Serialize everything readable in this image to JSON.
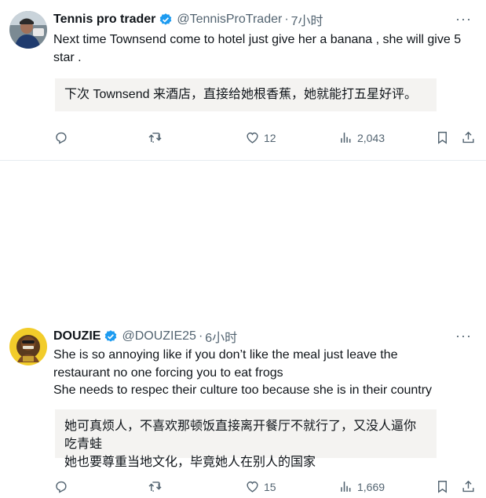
{
  "posts": [
    {
      "name": "Tennis pro trader",
      "handle": "@TennisProTrader",
      "time": "7小时",
      "text": "Next time Townsend come to hotel just give her a banana , she will give 5 star .",
      "translation": "下次 Townsend 来酒店，直接给她根香蕉，她就能打五星好评。",
      "likes": "12",
      "views": "2,043"
    },
    {
      "name": "DOUZIE",
      "handle": "@DOUZIE25",
      "time": "6小时",
      "text_lines": [
        "She is so annoying like if you don’t like the meal just leave the",
        "restaurant no one forcing you to eat frogs",
        "She needs to respec their culture too because she is in their country"
      ],
      "translation_lines": [
        "她可真烦人，不喜欢那顿饭直接离开餐厅不就行了，又没人逼你吃青蛙",
        "她也要尊重当地文化，毕竟她人在别人的国家"
      ],
      "likes": "15",
      "views": "1,669"
    }
  ],
  "separator": "·",
  "more_glyph": "···",
  "colors": {
    "text": "#0f1419",
    "secondary": "#536471",
    "verified": "#1d9bf0",
    "translation_bg": "#f4f3f1"
  },
  "icons": [
    "reply-icon",
    "repost-icon",
    "like-icon",
    "views-icon",
    "bookmark-icon",
    "share-icon",
    "verified-badge-icon",
    "more-icon"
  ]
}
